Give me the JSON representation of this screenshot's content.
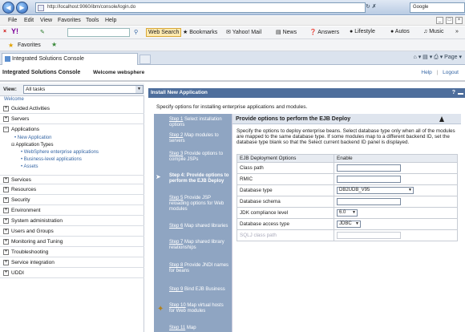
{
  "browser": {
    "url": "http://localhost:9060/ibm/console/login.do",
    "search_provider": "Google",
    "menu": [
      "File",
      "Edit",
      "View",
      "Favorites",
      "Tools",
      "Help"
    ],
    "toolbar": {
      "web_search": "Web Search",
      "bookmarks": "Bookmarks",
      "yahoo_mail": "Yahoo! Mail",
      "news": "News",
      "answers": "Answers",
      "lifestyle": "Lifestyle",
      "autos": "Autos",
      "music": "Music"
    },
    "favorites": "Favorites",
    "tab_title": "Integrated Solutions Console"
  },
  "console": {
    "title": "Integrated Solutions Console",
    "welcome": "Welcome websphere",
    "help": "Help",
    "logout": "Logout",
    "separator": "|"
  },
  "sidebar": {
    "view_label": "View:",
    "view_value": "All tasks",
    "welcome": "Welcome",
    "items": [
      "Guided Activities",
      "Servers",
      "Applications",
      "Services",
      "Resources",
      "Security",
      "Environment",
      "System administration",
      "Users and Groups",
      "Monitoring and Tuning",
      "Troubleshooting",
      "Service integration",
      "UDDI"
    ],
    "applications_sub": {
      "new_app": "New Application",
      "types_header": "Application Types",
      "types": [
        "WebSphere enterprise applications",
        "Business-level applications",
        "Assets"
      ]
    }
  },
  "panel": {
    "title": "Install New Application",
    "help_mark": "?",
    "intro": "Specify options for installing enterprise applications and modules.",
    "steps": [
      {
        "num": "Step 1",
        "text": "Select installation options"
      },
      {
        "num": "Step 2",
        "text": "Map modules to servers"
      },
      {
        "num": "Step 3",
        "text": "Provide options to compile JSPs"
      },
      {
        "num": "Step 4:",
        "text": "Provide options to perform the EJB Deploy"
      },
      {
        "num": "Step 5",
        "text": "Provide JSP reloading options for Web modules"
      },
      {
        "num": "Step 6",
        "text": "Map shared libraries"
      },
      {
        "num": "Step 7",
        "text": "Map shared library relationships"
      },
      {
        "num": "Step 8",
        "text": "Provide JNDI names for beans"
      },
      {
        "num": "Step 9",
        "text": "Bind EJB Business"
      },
      {
        "num": "Step 10",
        "text": "Map virtual hosts for Web modules"
      },
      {
        "num": "Step 11",
        "text": "Map"
      }
    ],
    "content_title": "Provide options to perform the EJB Deploy",
    "description": "Specify the options to deploy enterprise beans. Select database type only when all of the modules are mapped to the same database type. If some modules map to a different backend ID, set the database type blank so that the Select current backend ID panel is displayed.",
    "table": {
      "headers": [
        "EJB Deployment Options",
        "Enable"
      ],
      "rows": {
        "class_path": {
          "label": "Class path",
          "value": ""
        },
        "rmic": {
          "label": "RMIC",
          "value": ""
        },
        "database_type": {
          "label": "Database type",
          "value": "DB2UDB_V95"
        },
        "database_schema": {
          "label": "Database schema",
          "value": ""
        },
        "jdk_level": {
          "label": "JDK compliance level",
          "value": "6.0"
        },
        "db_access_type": {
          "label": "Database access type",
          "value": "JDBC"
        },
        "sqlj_class_path": {
          "label": "SQLJ class path",
          "value": ""
        }
      }
    }
  }
}
